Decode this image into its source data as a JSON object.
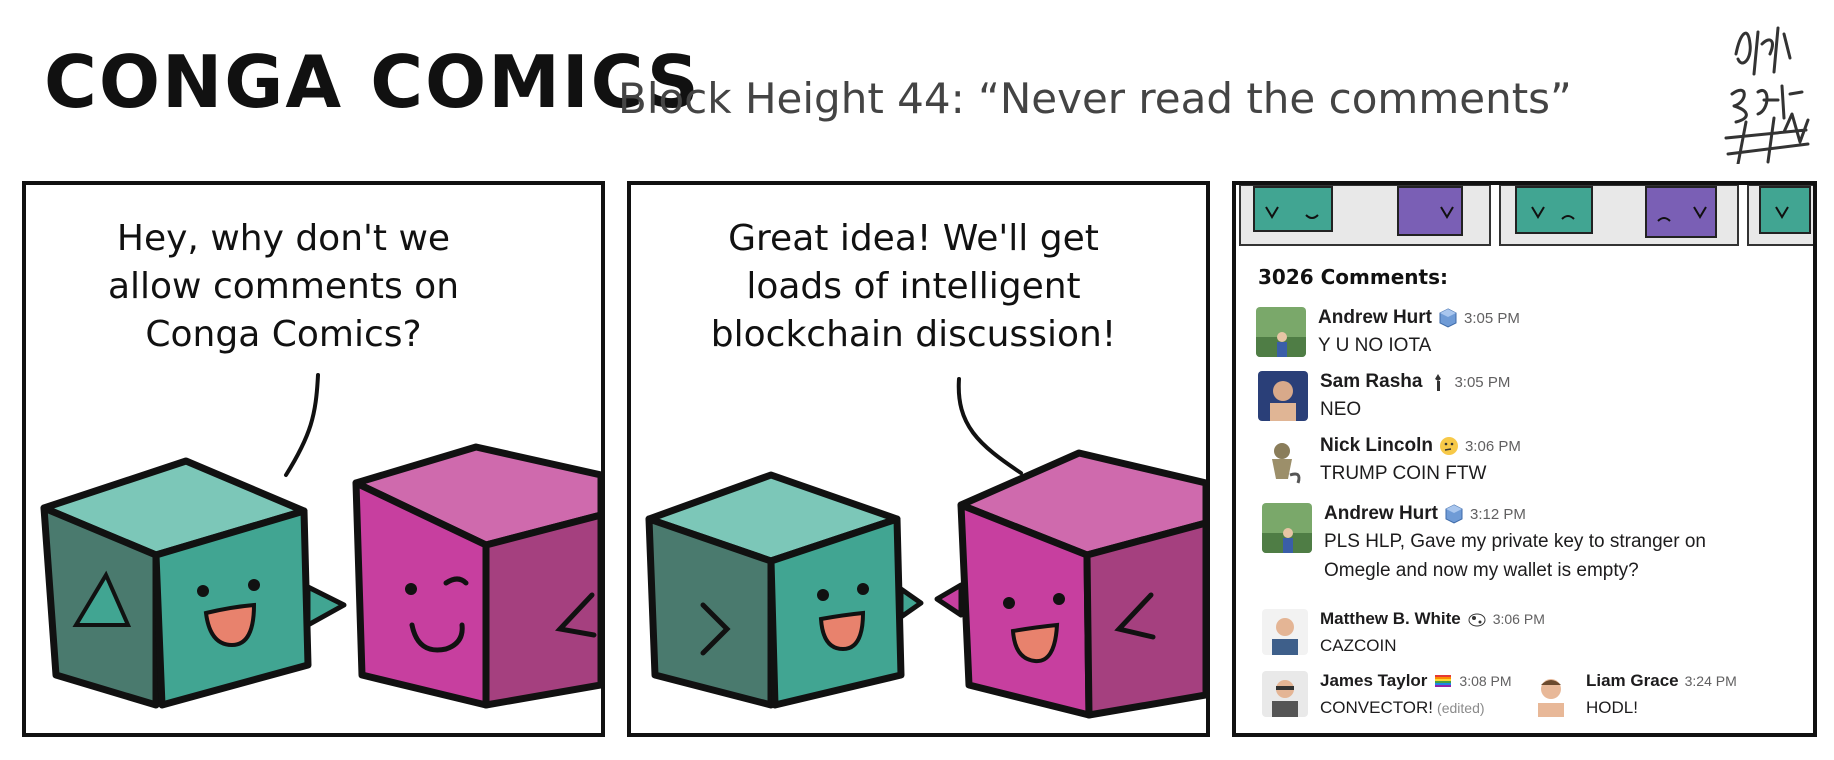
{
  "header": {
    "logo": "CONGA COMICS",
    "subtitle": "Block Height 44: “Never read the comments”"
  },
  "panels": [
    {
      "speech": "Hey, why don't we\nallow comments on\nConga Comics?"
    },
    {
      "speech": "Great idea!  We'll get\nloads of intelligent\nblockchain discussion!"
    }
  ],
  "thread": {
    "count_label": "3026 Comments:",
    "comments": [
      {
        "author": "Andrew Hurt",
        "badge": "cube-icon",
        "time": "3:05 PM",
        "text": "Y U NO IOTA"
      },
      {
        "author": "Sam Rasha",
        "badge": "torch-icon",
        "time": "3:05 PM",
        "text": "NEO"
      },
      {
        "author": "Nick Lincoln",
        "badge": "thinking-face-icon",
        "time": "3:06 PM",
        "text": "TRUMP COIN FTW"
      },
      {
        "author": "Andrew Hurt",
        "badge": "cube-icon",
        "time": "3:12 PM",
        "text": "PLS HLP, Gave my private key to stranger on Omegle and now my wallet is empty?"
      },
      {
        "author": "Matthew B. White",
        "badge": "cow-icon",
        "time": "3:06 PM",
        "text": "CAZCOIN"
      },
      {
        "author": "James Taylor",
        "badge": "rainbow-flag-icon",
        "time": "3:08 PM",
        "text": "CONVECTOR!",
        "edited": "(edited)"
      },
      {
        "author": "Liam Grace",
        "time": "3:24 PM",
        "text": "HODL!"
      }
    ]
  },
  "colors": {
    "teal_top": "#7cc7b8",
    "teal_front": "#41a592",
    "teal_side": "#4a7a6e",
    "magenta_top": "#cf6aad",
    "magenta_front": "#c73f9f",
    "magenta_side": "#a5407f",
    "mouth": "#e8826d"
  }
}
